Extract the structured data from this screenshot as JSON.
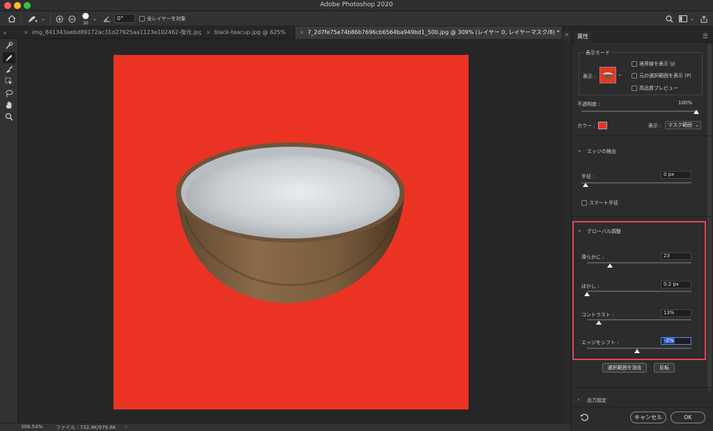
{
  "app": {
    "title": "Adobe Photoshop 2020"
  },
  "options_bar": {
    "brush_size": "30",
    "angle": "0°",
    "sample_all_layers_label": "全レイヤーを対象"
  },
  "tabs": [
    {
      "label": "img_841343aebd89172ac31d27925aa1123e102462-復元.jpg",
      "active": false
    },
    {
      "label": "black-teacup.jpg @ 625%",
      "active": false
    },
    {
      "label": "7_2d7fe75e74b86b7696cb6564ba949bd1_500.jpg @ 309% (レイヤー 0, レイヤーマスク/8) *",
      "active": true
    }
  ],
  "status": {
    "zoom": "308.54%",
    "file_info": "ファイル : 732.4K/976.6K",
    "arrow": "›"
  },
  "panel": {
    "tab_label": "属性",
    "view_mode": {
      "group_label": "表示モード",
      "view_label": "表示 :",
      "show_edge_label": "境界線を表示 (J)",
      "show_original_label": "元の選択範囲を表示 (P)",
      "hq_preview_label": "高品質プレビュー"
    },
    "opacity": {
      "label": "不透明度 :",
      "value": "100%",
      "level": 1.0
    },
    "color": {
      "label": "カラー :",
      "swatch": "#ea3323"
    },
    "display": {
      "label": "表示 :",
      "value": "マスク範囲"
    },
    "edge_detection": {
      "title": "エッジの検出",
      "radius_label": "半径 :",
      "radius_value": "0 px",
      "radius_level": 0.0,
      "smart_radius_label": "スマート半径"
    },
    "global_refinements": {
      "title": "グローバル調整",
      "smooth_label": "滑らかに :",
      "smooth_value": "23",
      "feather_label": "ぼかし :",
      "feather_value": "0.2 px",
      "contrast_label": "コントラスト :",
      "contrast_value": "13%",
      "shift_edge_label": "エッジをシフト :",
      "shift_edge_value": "-2%"
    },
    "clear_selection_label": "選択範囲を消去",
    "invert_label": "反転",
    "output_settings_label": "出力設定",
    "cancel_label": "キャンセル",
    "ok_label": "OK"
  },
  "colors": {
    "background_fill": "#ea3323",
    "highlight_box": "#e2475a"
  }
}
